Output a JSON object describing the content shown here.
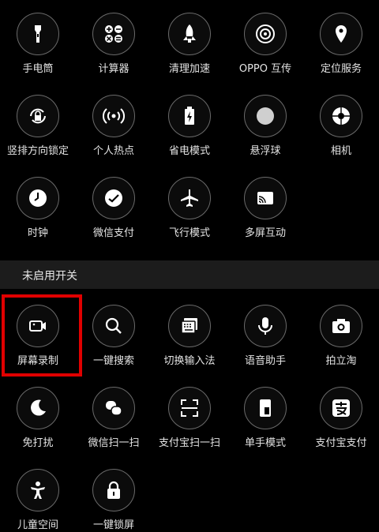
{
  "enabled": {
    "row1": [
      "手电筒",
      "计算器",
      "清理加速",
      "OPPO 互传",
      "定位服务"
    ],
    "row2": [
      "竖排方向锁定",
      "个人热点",
      "省电模式",
      "悬浮球",
      "相机"
    ],
    "row3": [
      "时钟",
      "微信支付",
      "飞行模式",
      "多屏互动"
    ]
  },
  "section_title": "未启用开关",
  "disabled": {
    "row1": [
      "屏幕录制",
      "一键搜索",
      "切换输入法",
      "语音助手",
      "拍立淘"
    ],
    "row2": [
      "免打扰",
      "微信扫一扫",
      "支付宝扫一扫",
      "单手模式",
      "支付宝支付"
    ],
    "row3": [
      "儿童空间",
      "一键锁屏"
    ]
  },
  "colors": {
    "highlight": "#e00000",
    "icon_border": "#6a6a6a"
  }
}
